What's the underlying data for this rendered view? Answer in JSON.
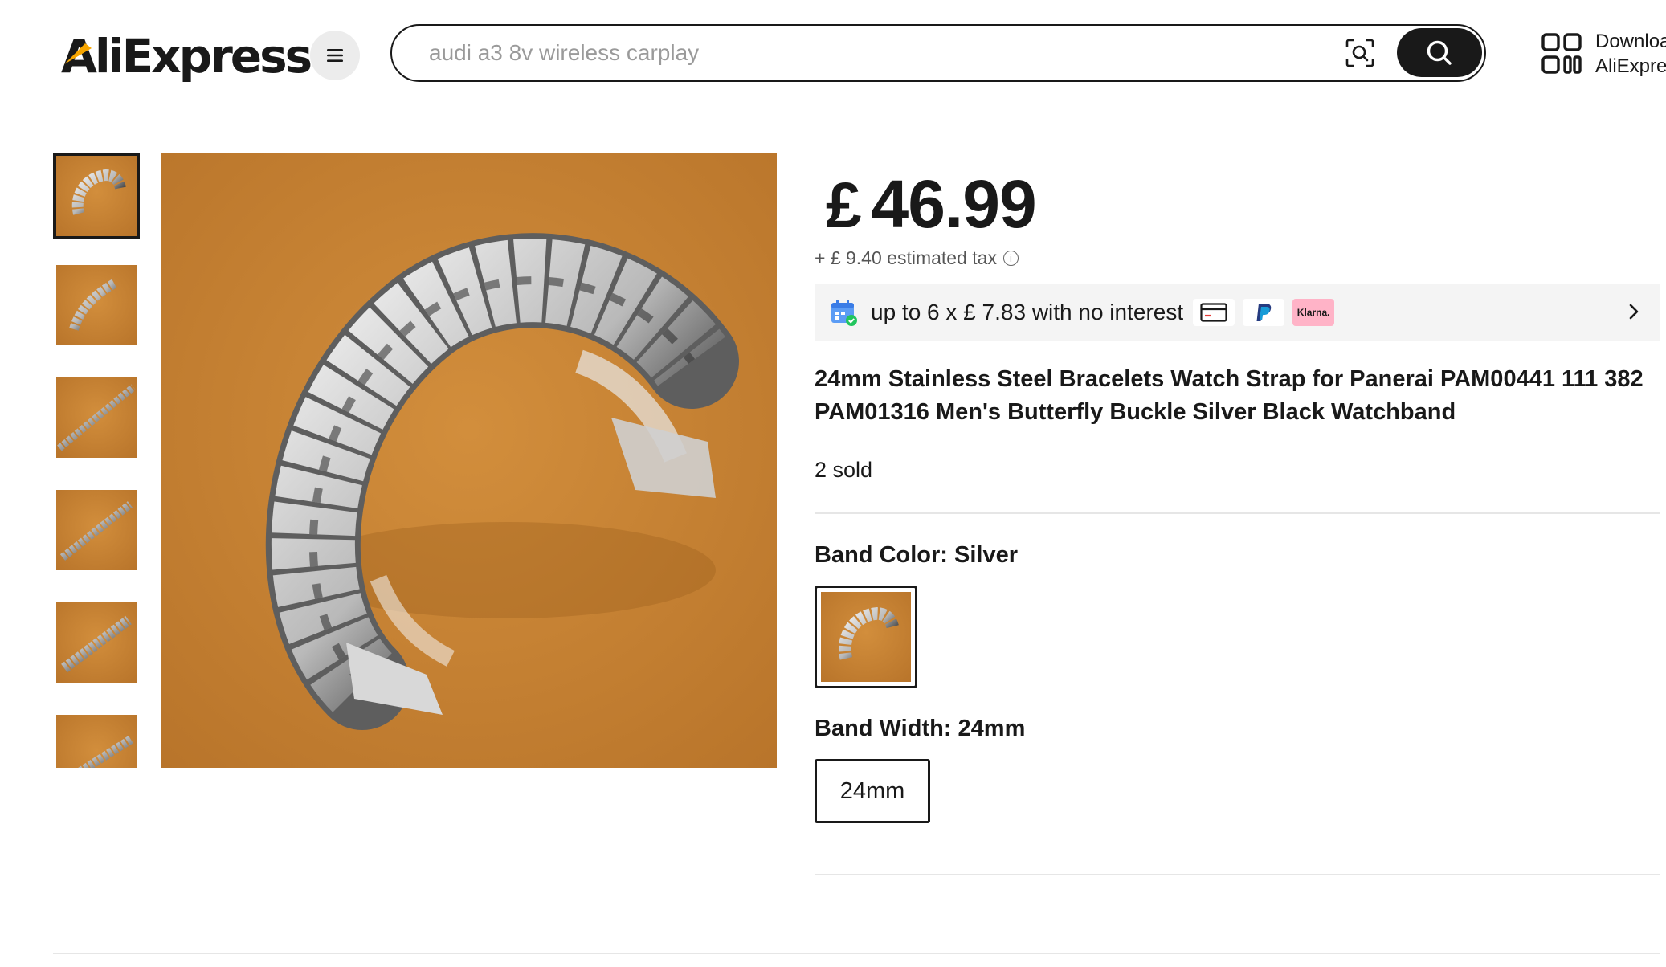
{
  "brand": {
    "logo_text": "AliExpress",
    "accent_color": "#f7a600"
  },
  "header": {
    "menu_icon": "hamburger-menu-icon",
    "search": {
      "placeholder": "audi a3 8v wireless carplay",
      "value": "",
      "camera_icon": "image-search-icon",
      "search_icon": "search-icon"
    },
    "download": {
      "icon": "qr-code-icon",
      "line1": "Download the",
      "line2": "AliExpress app"
    }
  },
  "gallery": {
    "thumbnail_count_visible": 6,
    "selected_index": 0,
    "background_color": "#c7822e"
  },
  "product": {
    "price": {
      "currency": "£",
      "amount": "46.99",
      "tax_note": "+ £ 9.40 estimated tax",
      "info_icon": "info-icon"
    },
    "installment": {
      "text": "up to 6 x  £ 7.83 with no interest",
      "calendar_icon": "installment-calendar-icon",
      "payment_methods": [
        "card-icon",
        "paypal-icon",
        "klarna-icon"
      ],
      "klarna_label": "Klarna.",
      "chevron_icon": "chevron-right-icon"
    },
    "title": "24mm Stainless Steel Bracelets Watch Strap for Panerai PAM00441 111 382 PAM01316 Men's Butterfly Buckle Silver Black Watchband",
    "sold": "2 sold",
    "band_color": {
      "label": "Band Color: Silver",
      "selected": "Silver"
    },
    "band_width": {
      "label": "Band Width: 24mm",
      "options": [
        "24mm"
      ],
      "selected": "24mm"
    }
  }
}
